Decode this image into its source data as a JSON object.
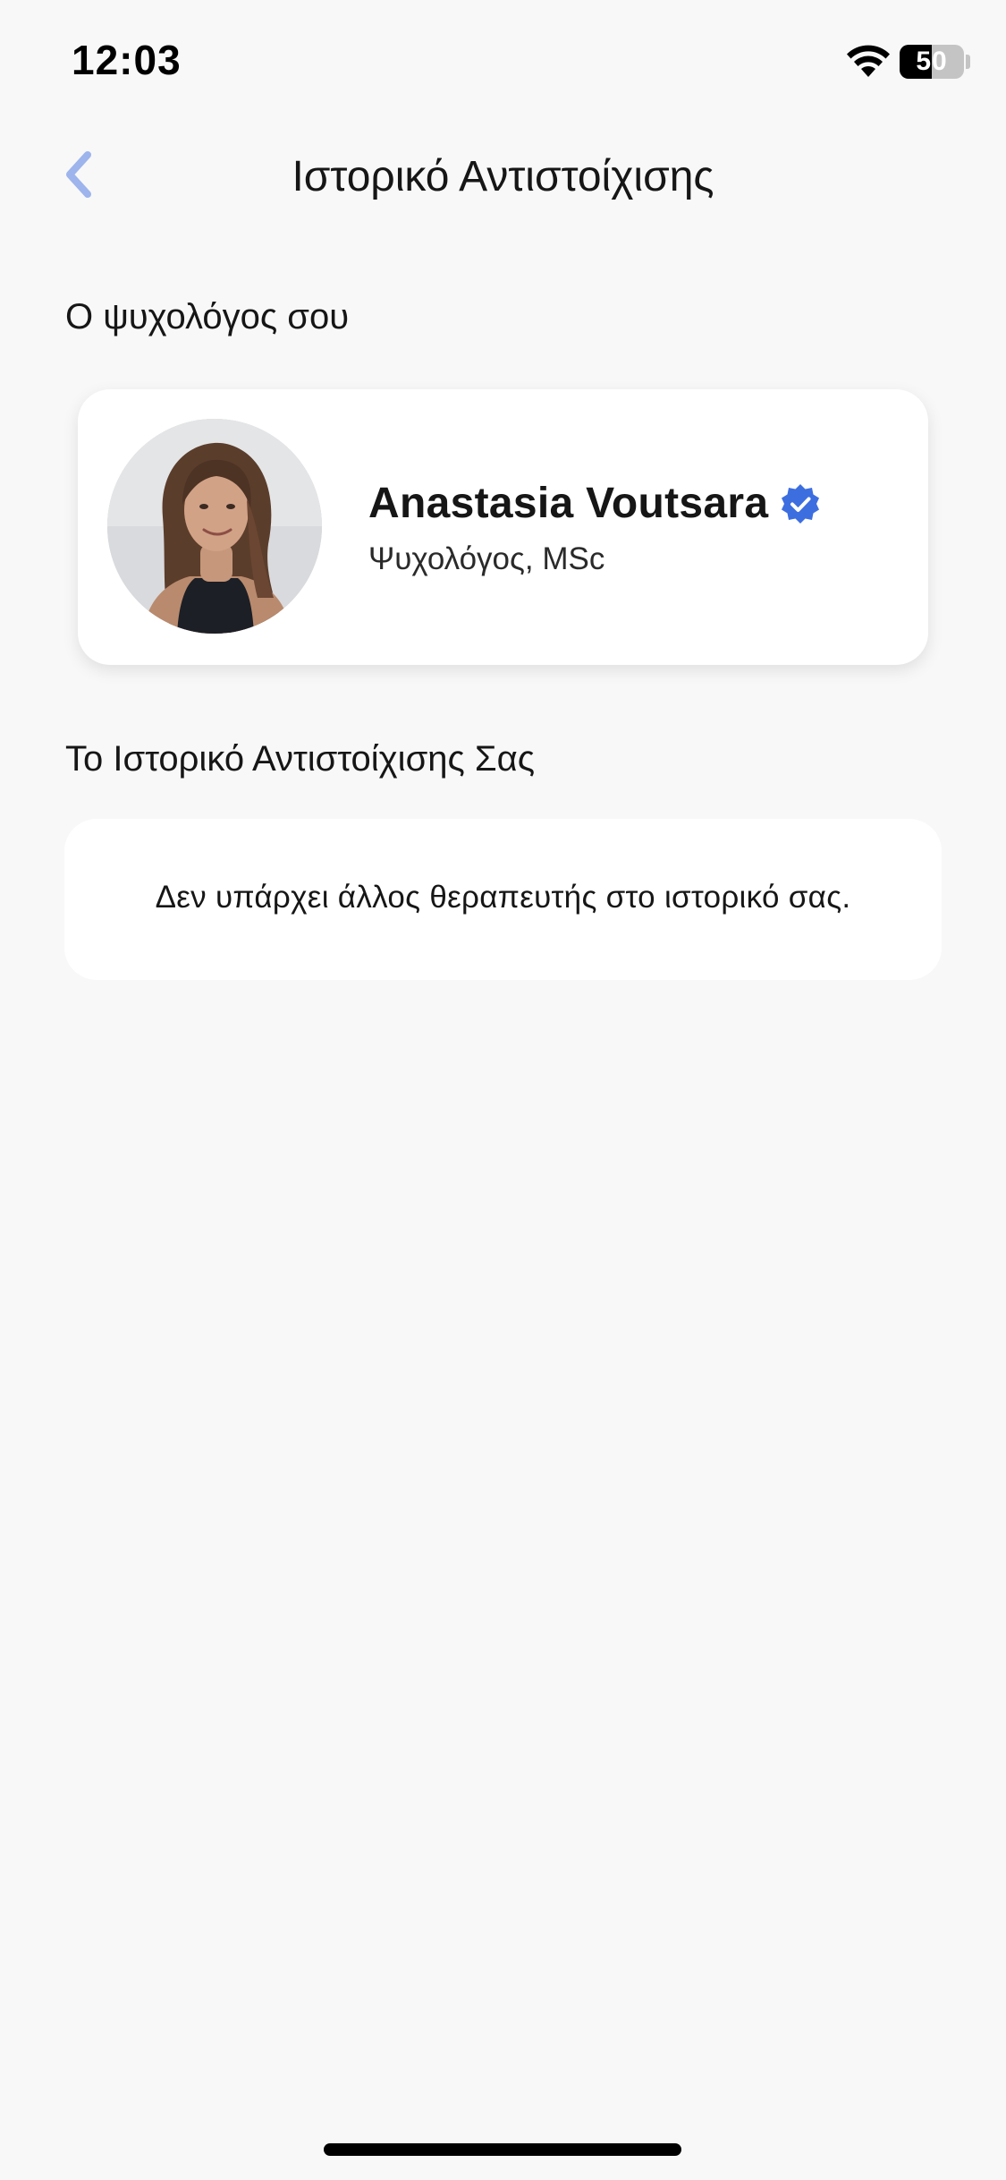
{
  "status_bar": {
    "time": "12:03",
    "battery_level": 50,
    "battery_text": "50",
    "wifi_icon": "wifi-icon"
  },
  "nav": {
    "back_icon": "chevron-left-icon",
    "title": "Ιστορικό Αντιστοίχισης"
  },
  "current_psychologist": {
    "section_heading": "Ο ψυχολόγος σου",
    "name": "Anastasia Voutsara",
    "verified_icon": "verified-badge-icon",
    "title": "Ψυχολόγος, MSc"
  },
  "history": {
    "section_heading": "Το Ιστορικό Αντιστοίχισης Σας",
    "empty_message": "Δεν υπάρχει άλλος θεραπευτής στο ιστορικό σας."
  },
  "colors": {
    "background": "#f8f8f8",
    "card": "#ffffff",
    "accent_blue": "#3d6ee0",
    "back_chevron": "#9db4ec"
  }
}
